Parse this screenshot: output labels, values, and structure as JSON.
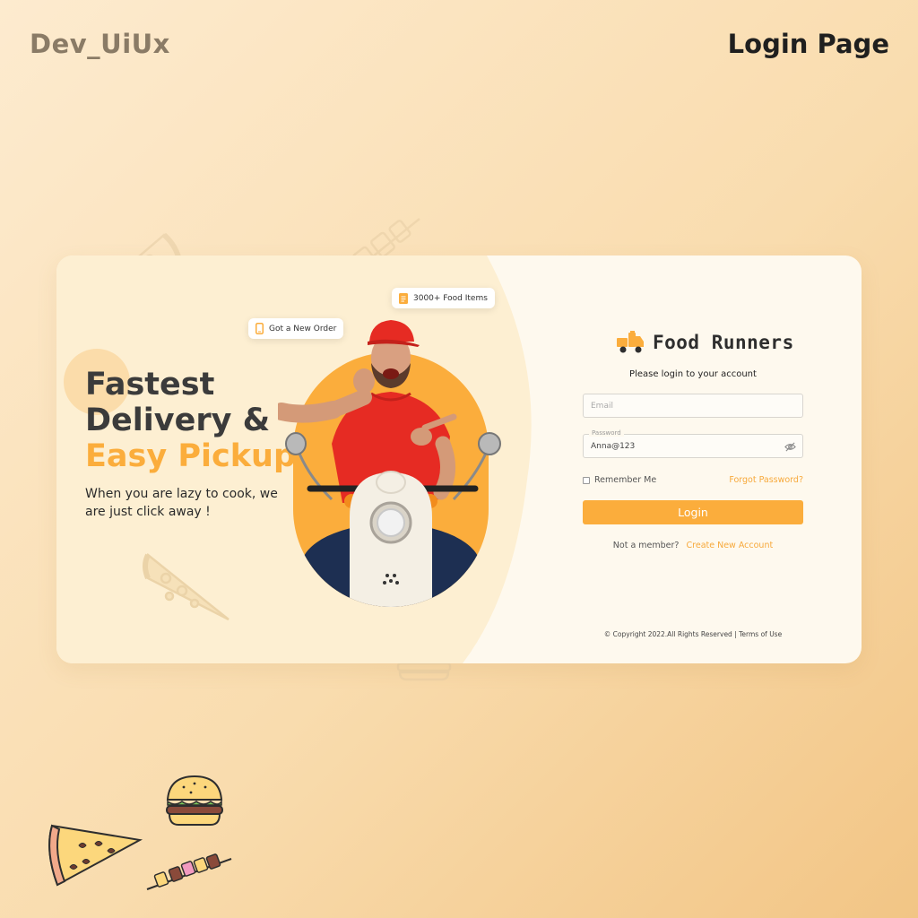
{
  "brand": "Dev_UiUx",
  "page_label": "Login Page",
  "hero": {
    "title_line1": "Fastest",
    "title_line2": "Delivery &",
    "title_line3": "Easy Pickup",
    "subtitle": "When you are lazy to cook, we are just click away !",
    "chip_order": "Got a New Order",
    "chip_food": "3000+ Food Items"
  },
  "login": {
    "app_name": "Food Runners",
    "subtitle": "Please login to your account",
    "email_placeholder": "Email",
    "password_label": "Password",
    "password_value": "Anna@123",
    "remember_label": "Remember Me",
    "forgot_label": "Forgot Password?",
    "login_button": "Login",
    "not_member": "Not a member?",
    "create_account": "Create New Account",
    "footer": "© Copyright 2022.All Rights Reserved | Terms of Use"
  },
  "colors": {
    "accent": "#fbad3c",
    "hero_bg": "#fdefd2",
    "panel_bg": "#fef9ee",
    "shirt": "#e62b23"
  },
  "icons": [
    "pizza-icon",
    "burger-icon",
    "kebab-icon",
    "phone-icon",
    "menu-book-icon",
    "delivery-truck-icon",
    "eye-off-icon"
  ]
}
